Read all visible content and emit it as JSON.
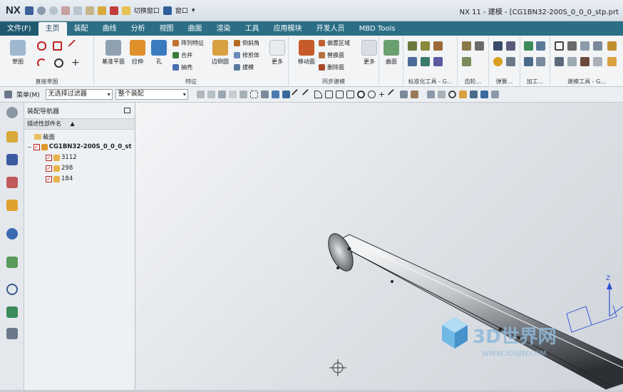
{
  "window": {
    "logo": "NX",
    "title": "NX 11 - 建模 - [CG1BN32-200S_0_0_0_stp.prt"
  },
  "quick_access": {
    "switch_window": "切换窗口",
    "window_menu": "窗口"
  },
  "tabs": [
    {
      "label": "文件(F)"
    },
    {
      "label": "主页"
    },
    {
      "label": "装配"
    },
    {
      "label": "曲线"
    },
    {
      "label": "分析"
    },
    {
      "label": "视图"
    },
    {
      "label": "曲面"
    },
    {
      "label": "渲染"
    },
    {
      "label": "工具"
    },
    {
      "label": "应用模块"
    },
    {
      "label": "开发人员"
    },
    {
      "label": "MBD Tools"
    }
  ],
  "ribbon": {
    "sketch": {
      "label": "草图",
      "group": "直接草图"
    },
    "datum_plane": "基准平面",
    "extrude": "拉伸",
    "hole": "孔",
    "pattern_feature": "阵列特征",
    "unite": "合并",
    "shell": "抽壳",
    "edge_blend": "边倒圆",
    "chamfer": "倒斜角",
    "trim_body": "修剪体",
    "draft": "拔模",
    "more_feature": "更多",
    "feature_group": "特征",
    "move_face": "移动面",
    "offset_region": "偏置区域",
    "replace_face": "替换面",
    "delete_face": "删除面",
    "more_sync": "更多",
    "sync_group": "同步建模",
    "surface": "曲面",
    "standard_tools": "标准化工具 - G...",
    "gear": "齿轮...",
    "spring": "弹簧...",
    "machining": "加工...",
    "modeling_tools": "建模工具 - G..."
  },
  "command_bar": {
    "menu": "菜单(M)",
    "selection_filter": "无选择过滤器",
    "assembly_scope": "整个装配"
  },
  "navigator": {
    "title": "装配导航器",
    "column": "描述性部件名",
    "section": "截面",
    "root": "CG1BN32-200S_0_0_0_st",
    "children": [
      {
        "name": "3112"
      },
      {
        "name": "298"
      },
      {
        "name": "184"
      }
    ]
  },
  "triad": {
    "axis": "Z"
  },
  "watermark": {
    "brand": "3D世界网",
    "url": "WWW.3DSJW.COM"
  }
}
